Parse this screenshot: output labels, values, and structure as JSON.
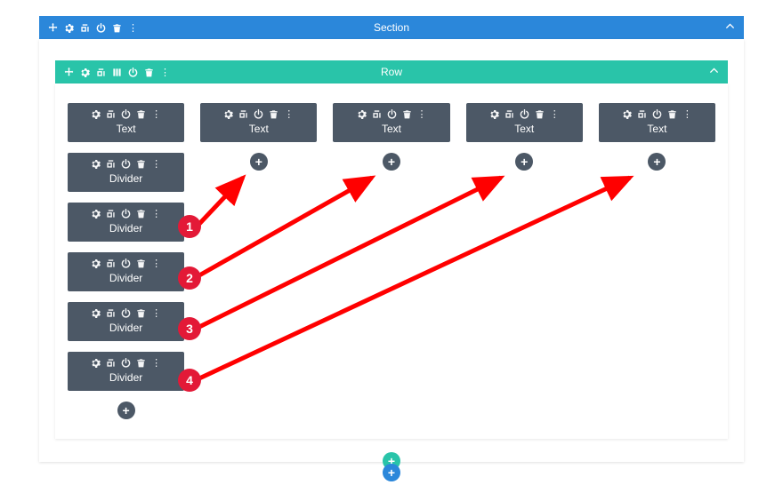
{
  "section": {
    "title": "Section",
    "toolbar_icons": [
      "move",
      "gear",
      "duplicate",
      "power",
      "trash",
      "more"
    ],
    "collapse_icon": "chevron-up"
  },
  "row": {
    "title": "Row",
    "toolbar_icons": [
      "move",
      "gear",
      "duplicate",
      "columns",
      "power",
      "trash",
      "more"
    ],
    "collapse_icon": "chevron-up"
  },
  "columns": [
    {
      "modules": [
        {
          "label": "Text",
          "icons": [
            "gear",
            "duplicate",
            "power",
            "trash",
            "more"
          ]
        },
        {
          "label": "Divider",
          "icons": [
            "gear",
            "duplicate",
            "power",
            "trash",
            "more"
          ]
        },
        {
          "label": "Divider",
          "icons": [
            "gear",
            "duplicate",
            "power",
            "trash",
            "more"
          ]
        },
        {
          "label": "Divider",
          "icons": [
            "gear",
            "duplicate",
            "power",
            "trash",
            "more"
          ]
        },
        {
          "label": "Divider",
          "icons": [
            "gear",
            "duplicate",
            "power",
            "trash",
            "more"
          ]
        },
        {
          "label": "Divider",
          "icons": [
            "gear",
            "duplicate",
            "power",
            "trash",
            "more"
          ]
        }
      ],
      "add_button": "+"
    },
    {
      "modules": [
        {
          "label": "Text",
          "icons": [
            "gear",
            "duplicate",
            "power",
            "trash",
            "more"
          ]
        }
      ],
      "add_button": "+"
    },
    {
      "modules": [
        {
          "label": "Text",
          "icons": [
            "gear",
            "duplicate",
            "power",
            "trash",
            "more"
          ]
        }
      ],
      "add_button": "+"
    },
    {
      "modules": [
        {
          "label": "Text",
          "icons": [
            "gear",
            "duplicate",
            "power",
            "trash",
            "more"
          ]
        }
      ],
      "add_button": "+"
    },
    {
      "modules": [
        {
          "label": "Text",
          "icons": [
            "gear",
            "duplicate",
            "power",
            "trash",
            "more"
          ]
        }
      ],
      "add_button": "+"
    }
  ],
  "row_add_button": "+",
  "section_add_button": "+",
  "annotations": {
    "callouts": [
      "1",
      "2",
      "3",
      "4"
    ],
    "arrow_color": "#FF0000"
  },
  "colors": {
    "section_header": "#2B87DA",
    "row_header": "#29C4A9",
    "module": "#4C5866",
    "callout": "#E31937"
  }
}
